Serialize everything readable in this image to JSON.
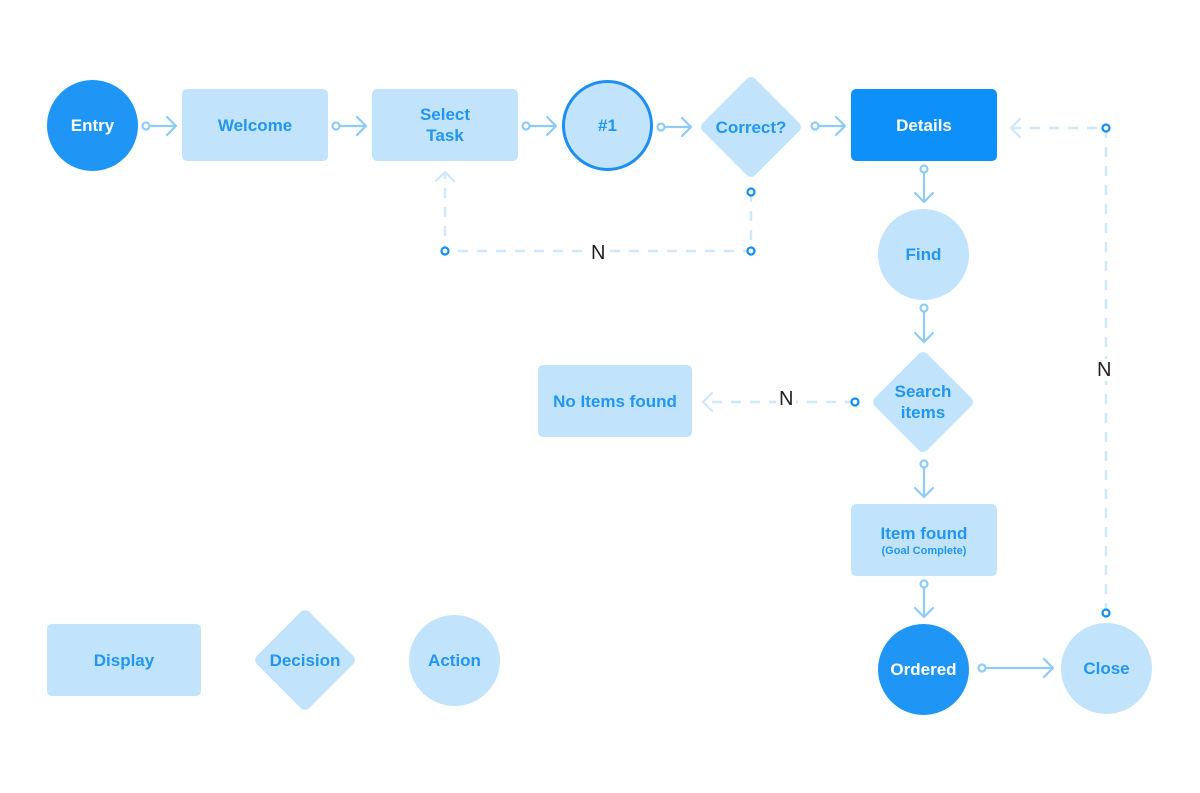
{
  "colors": {
    "light_fill": "#c2e3fc",
    "dark_fill": "#0e90fb",
    "text_blue": "#2196f3",
    "connector": "#8ecbf8",
    "dashed_connector": "#cfe8fc",
    "port_dot": "#0f8ff5"
  },
  "nodes": {
    "entry": {
      "label": "Entry",
      "shape": "action",
      "style": "filled"
    },
    "welcome": {
      "label": "Welcome",
      "shape": "display"
    },
    "select_task": {
      "line1": "Select",
      "line2": "Task",
      "shape": "display"
    },
    "step_one": {
      "label": "#1",
      "shape": "action",
      "style": "outlined"
    },
    "correct": {
      "label": "Correct?",
      "shape": "decision"
    },
    "details": {
      "label": "Details",
      "shape": "display",
      "style": "filled"
    },
    "find": {
      "label": "Find",
      "shape": "action"
    },
    "search_items": {
      "line1": "Search",
      "line2": "items",
      "shape": "decision"
    },
    "no_items_found": {
      "label": "No Items found",
      "shape": "display"
    },
    "item_found": {
      "label": "Item found",
      "sublabel": "(Goal Complete)",
      "shape": "display"
    },
    "ordered": {
      "label": "Ordered",
      "shape": "action",
      "style": "filled"
    },
    "close": {
      "label": "Close",
      "shape": "action"
    }
  },
  "edges": [
    {
      "from": "Entry",
      "to": "Welcome",
      "style": "solid"
    },
    {
      "from": "Welcome",
      "to": "Select Task",
      "style": "solid"
    },
    {
      "from": "Select Task",
      "to": "#1",
      "style": "solid"
    },
    {
      "from": "#1",
      "to": "Correct?",
      "style": "solid"
    },
    {
      "from": "Correct?",
      "to": "Details",
      "style": "solid"
    },
    {
      "from": "Correct?",
      "to": "Select Task",
      "style": "dashed",
      "label": "N"
    },
    {
      "from": "Details",
      "to": "Find",
      "style": "solid"
    },
    {
      "from": "Find",
      "to": "Search items",
      "style": "solid"
    },
    {
      "from": "Search items",
      "to": "No Items found",
      "style": "dashed",
      "label": "N"
    },
    {
      "from": "Search items",
      "to": "Item found",
      "style": "solid"
    },
    {
      "from": "Item found",
      "to": "Ordered",
      "style": "solid"
    },
    {
      "from": "Ordered",
      "to": "Close",
      "style": "solid"
    },
    {
      "from": "Close",
      "to": "Details",
      "style": "dashed",
      "label": "N"
    }
  ],
  "edge_labels": {
    "correct_no": "N",
    "search_no": "N",
    "close_no": "N"
  },
  "legend": {
    "display": "Display",
    "decision": "Decision",
    "action": "Action"
  }
}
